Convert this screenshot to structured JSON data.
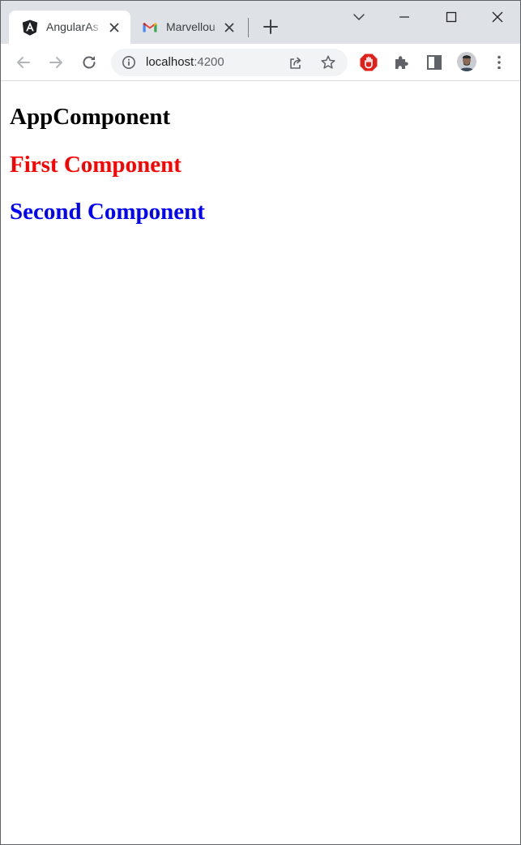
{
  "browser": {
    "tabs": [
      {
        "title": "AngularAs",
        "icon": "angular-icon",
        "active": true
      },
      {
        "title": "Marvellou",
        "icon": "gmail-icon",
        "active": false
      }
    ],
    "address": {
      "host": "localhost",
      "port": ":4200"
    }
  },
  "page": {
    "headings": [
      {
        "text": "AppComponent",
        "color": "#000000"
      },
      {
        "text": "First Component",
        "color": "#ff0000"
      },
      {
        "text": "Second Component",
        "color": "#0000ff"
      }
    ]
  },
  "colors": {
    "tabstrip": "#dee1e6",
    "omnibox": "#f1f3f4",
    "adblock_red": "#e0201b"
  }
}
